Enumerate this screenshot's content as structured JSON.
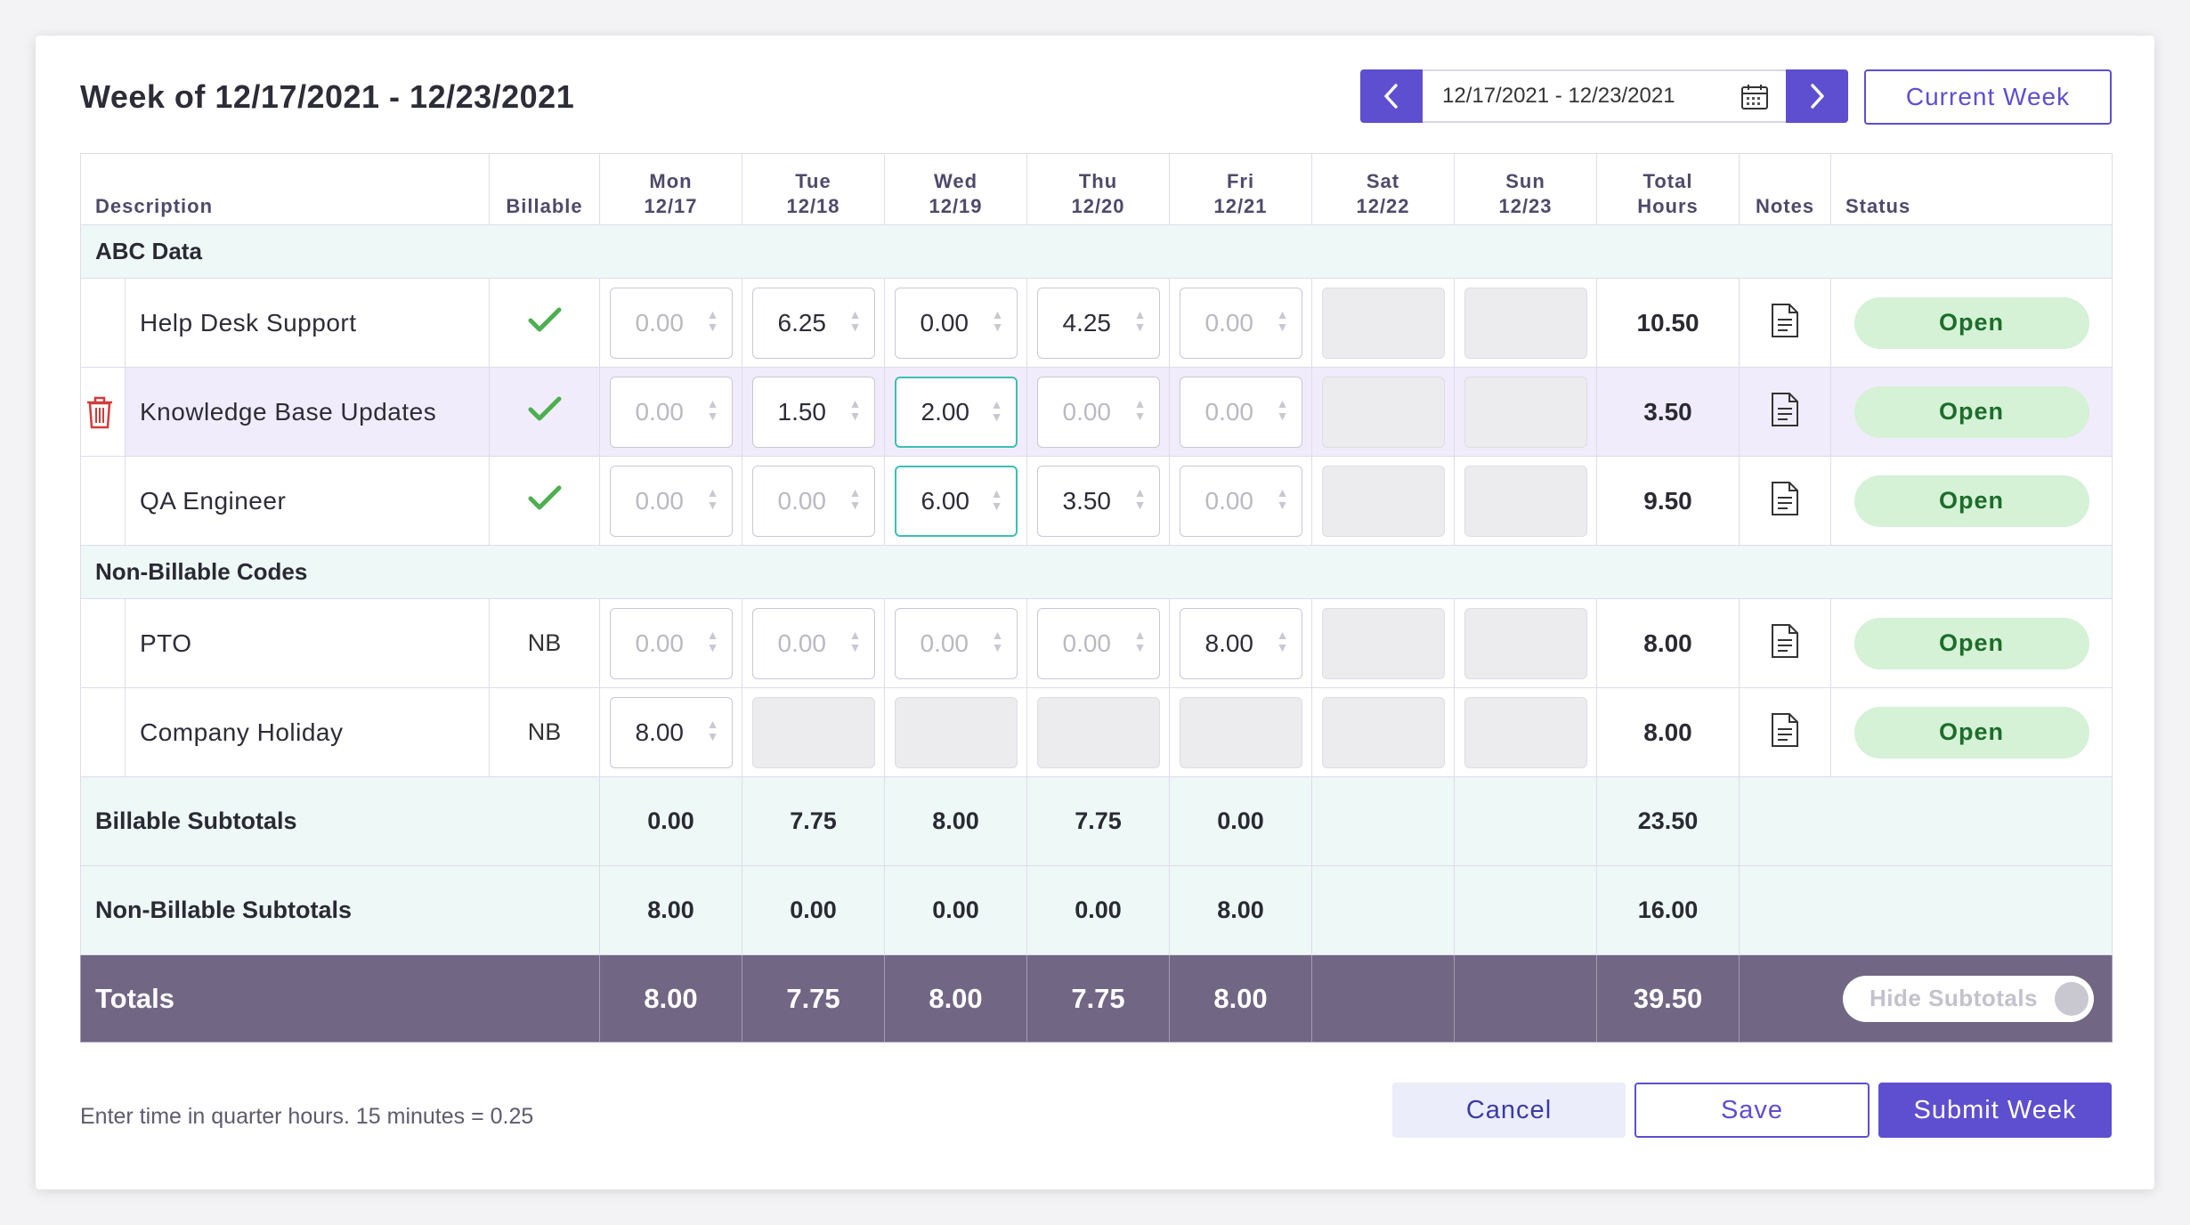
{
  "header": {
    "title": "Week of 12/17/2021 - 12/23/2021",
    "date_range": "12/17/2021 - 12/23/2021",
    "current_week_label": "Current Week"
  },
  "table": {
    "columns": {
      "description": "Description",
      "billable": "Billable",
      "days": [
        {
          "day": "Mon",
          "date": "12/17"
        },
        {
          "day": "Tue",
          "date": "12/18"
        },
        {
          "day": "Wed",
          "date": "12/19"
        },
        {
          "day": "Thu",
          "date": "12/20"
        },
        {
          "day": "Fri",
          "date": "12/21"
        },
        {
          "day": "Sat",
          "date": "12/22"
        },
        {
          "day": "Sun",
          "date": "12/23"
        }
      ],
      "total_line1": "Total",
      "total_line2": "Hours",
      "notes": "Notes",
      "status": "Status"
    },
    "groups": [
      {
        "name": "ABC Data",
        "rows": [
          {
            "description": "Help Desk Support",
            "billable": "check",
            "hours": [
              "0.00",
              "6.25",
              "0.00",
              "4.25",
              "0.00"
            ],
            "total": "10.50",
            "status": "Open"
          },
          {
            "description": "Knowledge Base Updates",
            "billable": "check",
            "hours": [
              "0.00",
              "1.50",
              "2.00",
              "0.00",
              "0.00"
            ],
            "total": "3.50",
            "status": "Open"
          },
          {
            "description": "QA Engineer",
            "billable": "check",
            "hours": [
              "0.00",
              "0.00",
              "6.00",
              "3.50",
              "0.00"
            ],
            "total": "9.50",
            "status": "Open"
          }
        ]
      },
      {
        "name": "Non-Billable Codes",
        "rows": [
          {
            "description": "PTO",
            "billable": "NB",
            "hours": [
              "0.00",
              "0.00",
              "0.00",
              "0.00",
              "8.00"
            ],
            "total": "8.00",
            "status": "Open"
          },
          {
            "description": "Company Holiday",
            "billable": "NB",
            "hours": [
              "8.00"
            ],
            "total": "8.00",
            "status": "Open"
          }
        ]
      }
    ],
    "billable_subtotals": {
      "label": "Billable Subtotals",
      "values": [
        "0.00",
        "7.75",
        "8.00",
        "7.75",
        "0.00"
      ],
      "total": "23.50"
    },
    "nonbillable_subtotals": {
      "label": "Non-Billable Subtotals",
      "values": [
        "8.00",
        "0.00",
        "0.00",
        "0.00",
        "8.00"
      ],
      "total": "16.00"
    },
    "totals": {
      "label": "Totals",
      "values": [
        "8.00",
        "7.75",
        "8.00",
        "7.75",
        "8.00"
      ],
      "total": "39.50",
      "toggle_label": "Hide Subtotals"
    }
  },
  "footer": {
    "hint": "Enter time in quarter hours. 15 minutes = 0.25",
    "cancel_label": "Cancel",
    "save_label": "Save",
    "submit_label": "Submit Week"
  },
  "colors": {
    "accent": "#5e4ed0",
    "teal_focus": "#3cbfb5",
    "totals_bg": "#716683",
    "status_bg": "#d5f1d6",
    "check_green": "#4caf50",
    "trash_red": "#d33b3b"
  },
  "icons": {
    "prev": "chevron-left-icon",
    "next": "chevron-right-icon",
    "calendar": "calendar-icon",
    "notes": "document-icon",
    "billable": "checkmark-icon",
    "delete": "trash-icon"
  }
}
